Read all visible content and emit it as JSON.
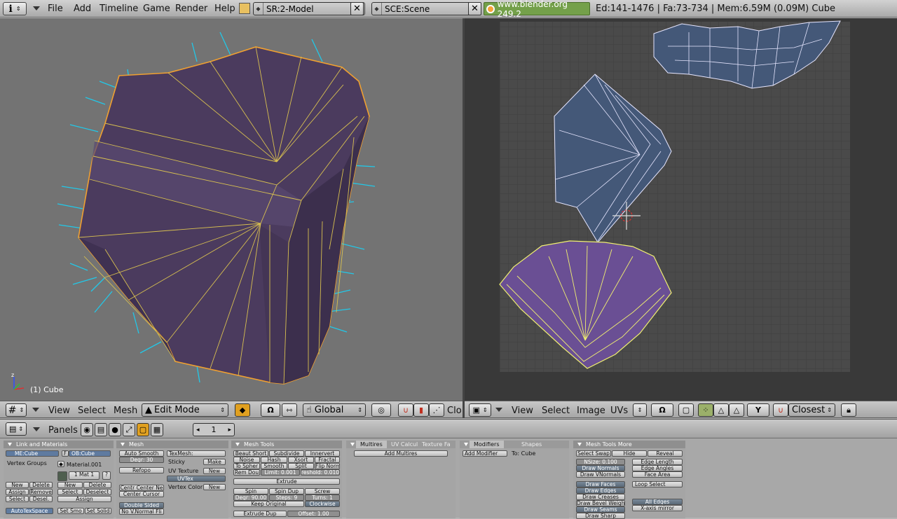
{
  "topbar": {
    "menus": [
      "File",
      "Add",
      "Timeline",
      "Game",
      "Render",
      "Help"
    ],
    "screen_field": "SR:2-Model",
    "scene_field": "SCE:Scene",
    "close_glyph": "✕",
    "website": "www.blender.org 249.2",
    "stats": "Ed:141-1476 | Fa:73-734 | Mem:6.59M (0.09M) Cube"
  },
  "viewport3d": {
    "object_info": "(1) Cube",
    "colors": {
      "background": "#737373",
      "face": "#4b3b5e",
      "edge_selected": "#f0a030",
      "normals": "#22c8e8"
    }
  },
  "viewport_header": {
    "view_label": "View",
    "select_label": "Select",
    "mesh_label": "Mesh",
    "mode": "Edit Mode",
    "orientation": "Global",
    "clipped": "Clo"
  },
  "uv_header": {
    "view_label": "View",
    "select_label": "Select",
    "image_label": "Image",
    "uvs_label": "UVs",
    "snap_mode": "Closest"
  },
  "buttons_header": {
    "panels_label": "Panels",
    "frame": "1"
  },
  "link_materials": {
    "title": "Link and Materials",
    "me_field": "ME:Cube",
    "f_toggle": "F",
    "ob_field": "OB:Cube",
    "vertex_groups": "Vertex Groups",
    "material": "Material.001",
    "mat_slot": "1 Mat 1",
    "question": "?",
    "vg_buttons": [
      "New",
      "Delete",
      "Assign",
      "Remove",
      "Select",
      "Desel."
    ],
    "mat_buttons": [
      "New",
      "Delete",
      "Select",
      "Deselect",
      "Assign"
    ],
    "autotexspace": "AutoTexSpace",
    "set_smooth": "Set Smo",
    "set_solid": "Set Solid"
  },
  "mesh": {
    "title": "Mesh",
    "auto_smooth": "Auto Smooth",
    "degr": "Degr: 30",
    "refopo": "Refopo",
    "center_new": "Centr Center Ne",
    "center_cursor": "Center Cursor",
    "double_sided": "Double Sided",
    "no_vnormal": "No V.Normal Fli",
    "texmesh": "TexMesh:",
    "sticky": "Sticky",
    "make": "Make",
    "uv_texture": "UV Texture",
    "new1": "New",
    "uvtex": "UVTex",
    "vertex_color": "Vertex Color",
    "new2": "New"
  },
  "mesh_tools": {
    "title": "Mesh Tools",
    "row1": [
      "Beaut Short",
      "Subdivide",
      "Innervert"
    ],
    "row2": [
      "Noise",
      "Hash",
      "Xsort",
      "Fractal"
    ],
    "row3": [
      "To Spher",
      "Smooth",
      "Split",
      "Flip Norm"
    ],
    "rem_doubles": "Rem Dou",
    "limit": "Limit: 0.001",
    "threshold": "reshold: 0.010",
    "extrude": "Extrude",
    "spin_row": [
      "Spin",
      "Spin Dup",
      "Screw"
    ],
    "degr": "Degr: 90.00",
    "steps": "Steps: 9",
    "turns": "Turns: 1",
    "keep_original": "Keep Original",
    "clockwise": "Clockwise",
    "extrude_dup": "Extrude Dup",
    "offset": "Offset: 1.00"
  },
  "multires": {
    "tabs": [
      "Multires",
      "UV Calcul",
      "Texture Fa"
    ],
    "add_multires": "Add Multires"
  },
  "modifiers": {
    "tabs": [
      "Modifiers",
      "Shapes"
    ],
    "add_modifier": "Add Modifier",
    "to": "To: Cube"
  },
  "mesh_tools_more": {
    "title": "Mesh Tools More",
    "row1": [
      "Select Swap",
      "Hide",
      "Reveal"
    ],
    "nsize": "NSize: 0.100",
    "draw_normals": "Draw Normals",
    "draw_vnormals": "Draw VNormals",
    "edge_length": "Edge Length",
    "edge_angles": "Edge Angles",
    "face_area": "Face Area",
    "draw_faces": "Draw Faces",
    "draw_edges": "Draw Edges",
    "draw_creases": "Draw Creases",
    "draw_bevel": "Draw Bevel Weigh",
    "draw_seams": "Draw Seams",
    "draw_sharp": "Draw Sharp",
    "loop_select": "Loop Select",
    "all_edges": "All Edges",
    "xaxis_mirror": "X-axis mirror"
  }
}
